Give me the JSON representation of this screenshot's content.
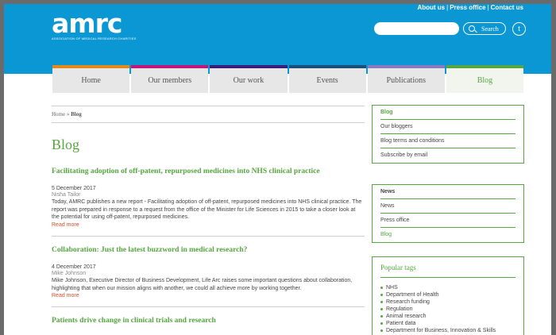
{
  "header": {
    "logo_text": "amrc",
    "logo_subtitle": "ASSOCIATION OF MEDICAL RESEARCH CHARITIES",
    "links": [
      "About us",
      "Press office",
      "Contact us"
    ],
    "search_placeholder": "",
    "search_label": "Search"
  },
  "nav": {
    "items": [
      {
        "label": "Home",
        "color": "#e08a1e"
      },
      {
        "label": "Our members",
        "color": "#c2167a"
      },
      {
        "label": "Our work",
        "color": "#3a1c79"
      },
      {
        "label": "Events",
        "color": "#1b4f7a"
      },
      {
        "label": "Publications",
        "color": "#8a7ac0"
      },
      {
        "label": "Blog",
        "color": "#55a540"
      }
    ]
  },
  "breadcrumb": {
    "home": "Home",
    "sep": "»",
    "current": "Blog"
  },
  "page_title": "Blog",
  "articles": [
    {
      "title": "Facilitating adoption of off-patent, repurposed medicines into NHS clinical practice",
      "date": "5 December 2017",
      "author": "Nisha Tailor",
      "body": "Today, AMRC publishes a new report - Facilitating adoption of off-patent, repurposed medicines into NHS clinical practice. The report was prepared in response to a request from the office of the Minister for Life Sciences in 2015 to take a closer look at the potential for using off-patent, repurposed medicines.",
      "more": "Read more"
    },
    {
      "title": "Collaboration: Just the latest buzzword in medical research?",
      "date": "4 December 2017",
      "author": "Mike Johnson",
      "body": "Mike Johnson, Executive Director of Business Development, Life Arc raises some important questions about collaboration, highlighting that when our mission aligns with another, we could all achieve more by working together.",
      "more": "Read more"
    },
    {
      "title": "Patients drive change in clinical trials and research"
    }
  ],
  "sidebar": {
    "blog_box": [
      "Blog",
      "Our bloggers",
      "Blog terms and conditions",
      "Subscribe by email"
    ],
    "news_box": [
      "News",
      "News",
      "Press office",
      "Blog"
    ],
    "tags_title": "Popular tags",
    "tags": [
      "NHS",
      "Department of Health",
      "Research funding",
      "Regulation",
      "Animal research",
      "Patient data",
      "Department for Business, Innovation & Skills"
    ]
  }
}
